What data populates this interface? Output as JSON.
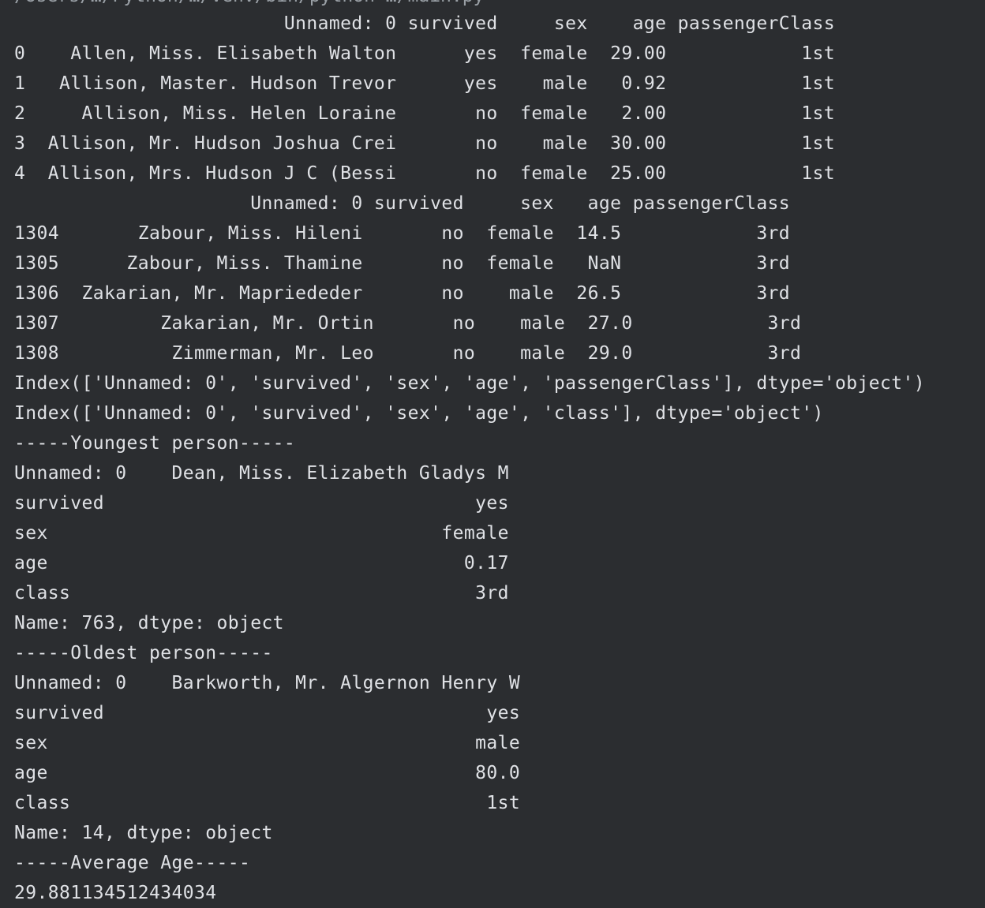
{
  "console": {
    "truncated_top_line": "/Users/…/Python/…/venv/bin/python …/main.py",
    "lines": [
      "                        Unnamed: 0 survived     sex    age passengerClass",
      "0    Allen, Miss. Elisabeth Walton      yes  female  29.00            1st",
      "1   Allison, Master. Hudson Trevor      yes    male   0.92            1st",
      "2     Allison, Miss. Helen Loraine       no  female   2.00            1st",
      "3  Allison, Mr. Hudson Joshua Crei       no    male  30.00            1st",
      "4  Allison, Mrs. Hudson J C (Bessi       no  female  25.00            1st",
      "                     Unnamed: 0 survived     sex   age passengerClass",
      "1304       Zabour, Miss. Hileni       no  female  14.5            3rd",
      "1305      Zabour, Miss. Thamine       no  female   NaN            3rd",
      "1306  Zakarian, Mr. Mapriededer       no    male  26.5            3rd",
      "1307         Zakarian, Mr. Ortin       no    male  27.0            3rd",
      "1308          Zimmerman, Mr. Leo       no    male  29.0            3rd",
      "Index(['Unnamed: 0', 'survived', 'sex', 'age', 'passengerClass'], dtype='object')",
      "Index(['Unnamed: 0', 'survived', 'sex', 'age', 'class'], dtype='object')",
      "-----Youngest person-----",
      "Unnamed: 0    Dean, Miss. Elizabeth Gladys M",
      "survived                                 yes",
      "sex                                   female",
      "age                                     0.17",
      "class                                    3rd",
      "Name: 763, dtype: object",
      "-----Oldest person-----",
      "Unnamed: 0    Barkworth, Mr. Algernon Henry W",
      "survived                                  yes",
      "sex                                      male",
      "age                                      80.0",
      "class                                     1st",
      "Name: 14, dtype: object",
      "-----Average Age-----",
      "29.881134512434034"
    ]
  }
}
